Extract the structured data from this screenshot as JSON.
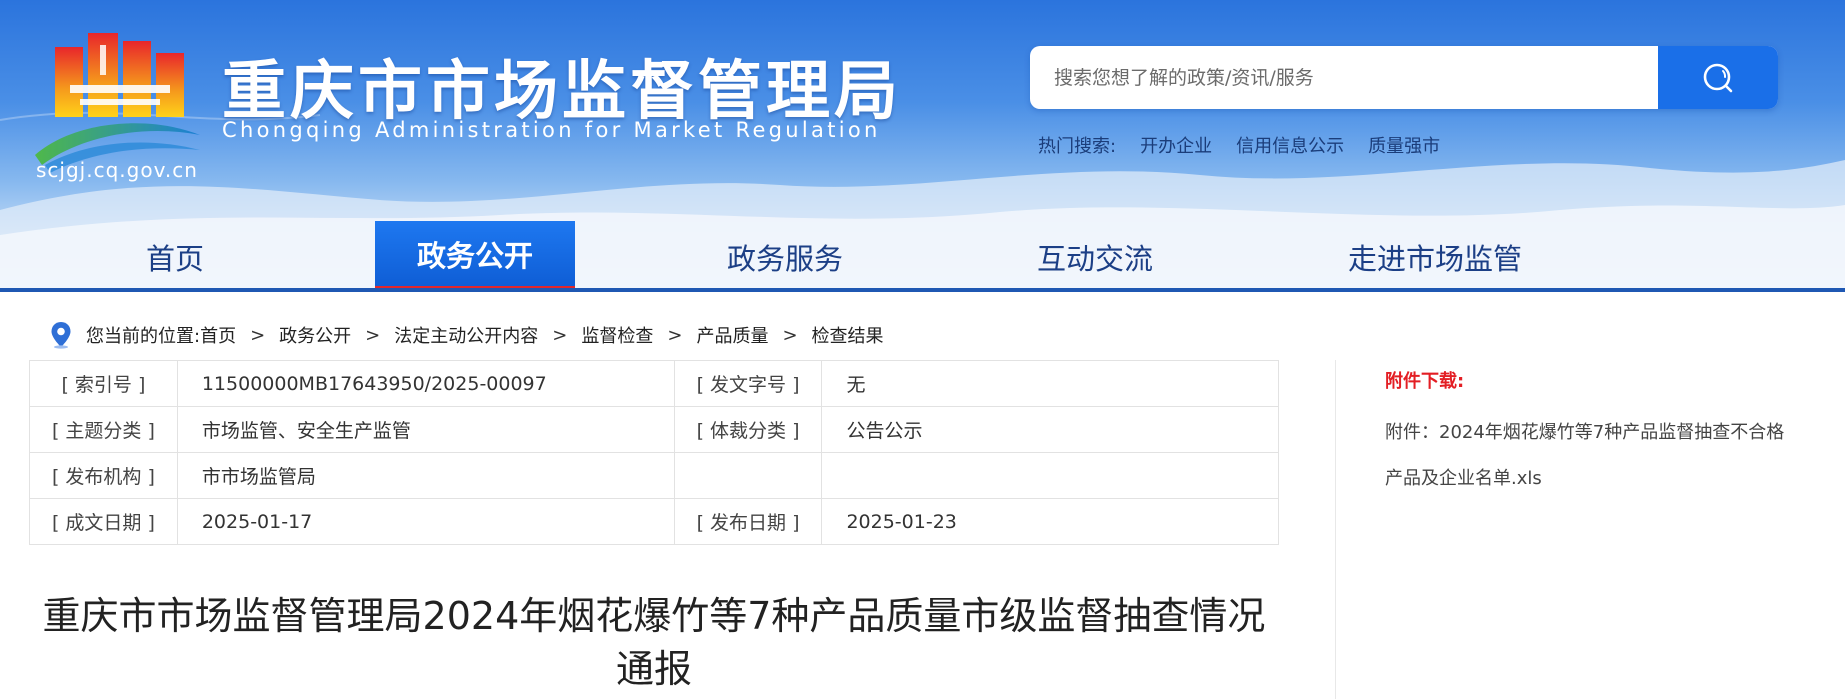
{
  "header": {
    "site_title": "重庆市市场监督管理局",
    "site_subtitle": "Chongqing  Administration for Market Regulation",
    "domain": "scjgj.cq.gov.cn",
    "search": {
      "placeholder": "搜索您想了解的政策/资讯/服务",
      "button_icon": "search-icon"
    },
    "hot_search": {
      "label": "热门搜索:",
      "links": [
        "开办企业",
        "信用信息公示",
        "质量强市"
      ]
    }
  },
  "nav": {
    "items": [
      "首页",
      "政务公开",
      "政务服务",
      "互动交流",
      "走进市场监管"
    ],
    "active_index": 1
  },
  "breadcrumb": {
    "prefix": "您当前的位置:",
    "items": [
      "首页",
      "政务公开",
      "法定主动公开内容",
      "监督检查",
      "产品质量",
      "检查结果"
    ],
    "separator": ">"
  },
  "meta": {
    "rows": [
      {
        "label1": "[ 索引号 ]",
        "value1": "11500000MB17643950/2025-00097",
        "label2": "[ 发文字号 ]",
        "value2": "无"
      },
      {
        "label1": "[ 主题分类 ]",
        "value1": "市场监管、安全生产监管",
        "label2": "[ 体裁分类 ]",
        "value2": "公告公示"
      },
      {
        "label1": "[ 发布机构 ]",
        "value1": "市市场监管局",
        "label2": "",
        "value2": ""
      },
      {
        "label1": "[ 成文日期 ]",
        "value1": "2025-01-17",
        "label2": "[ 发布日期 ]",
        "value2": "2025-01-23"
      }
    ]
  },
  "article": {
    "title": "重庆市市场监督管理局2024年烟花爆竹等7种产品质量市级监督抽查情况通报"
  },
  "sidebar": {
    "attachment_title": "附件下载:",
    "attachment_link": "附件：2024年烟花爆竹等7种产品监督抽查不合格产品及企业名单.xls"
  },
  "colors": {
    "brand_blue": "#1a6fe8",
    "nav_text": "#1c3f86",
    "active_underline": "#e3262a",
    "attachment_red": "#e31e24"
  }
}
